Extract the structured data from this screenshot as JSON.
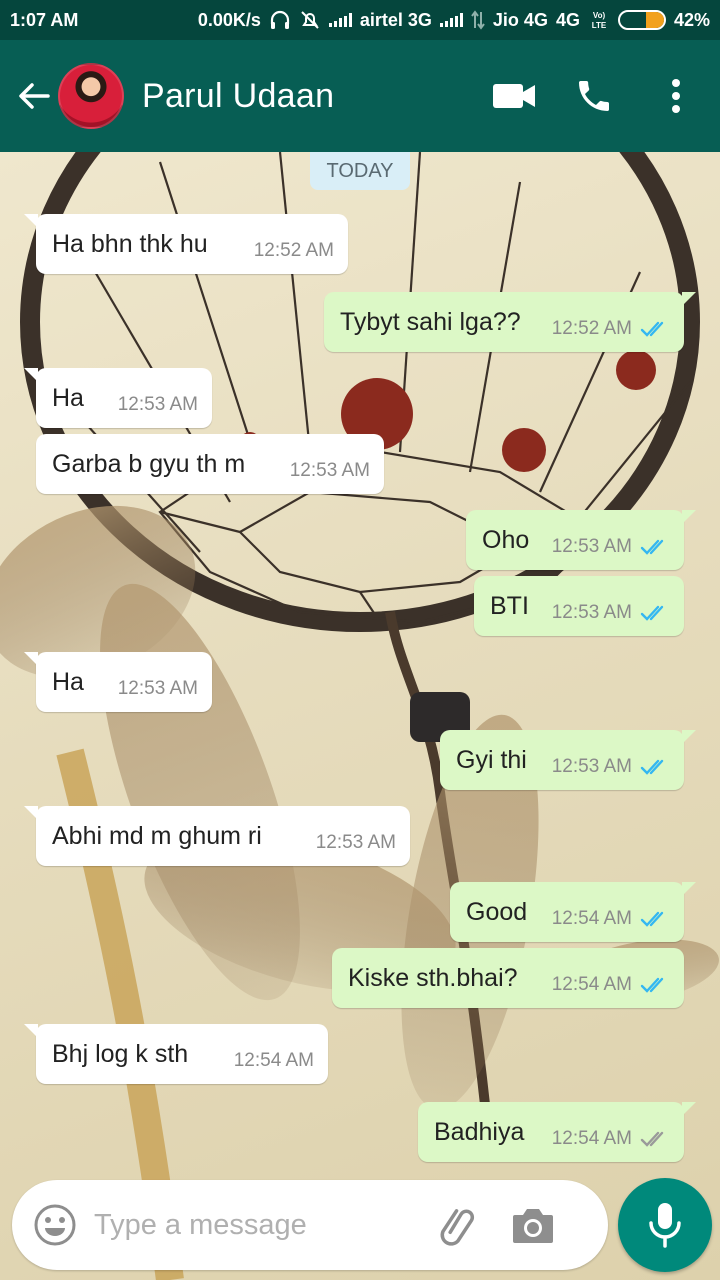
{
  "status_bar": {
    "time": "1:07 AM",
    "speed": "0.00K/s",
    "carrier1": "airtel 3G",
    "carrier2": "Jio 4G",
    "network2": "4G",
    "volte": "Vo) LTE",
    "battery": "42%",
    "battery_level": 0.42,
    "battery_color": "#f2a11d"
  },
  "header": {
    "contact_name": "Parul Udaan",
    "back_icon": "arrow-left-icon",
    "video_icon": "video-camera-icon",
    "call_icon": "phone-icon",
    "menu_icon": "more-vertical-icon",
    "color": "#075e54"
  },
  "date_chip": "TODAY",
  "messages": [
    {
      "dir": "in",
      "text": "Ha bhn thk hu",
      "time": "12:52 AM"
    },
    {
      "dir": "out",
      "text": "Tybyt sahi lga??",
      "time": "12:52 AM",
      "ticks": "read"
    },
    {
      "dir": "in",
      "text": "Ha",
      "time": "12:53 AM"
    },
    {
      "dir": "in",
      "text": "Garba b gyu th m",
      "time": "12:53 AM"
    },
    {
      "dir": "out",
      "text": "Oho",
      "time": "12:53 AM",
      "ticks": "read"
    },
    {
      "dir": "out",
      "text": "BTI",
      "time": "12:53 AM",
      "ticks": "read"
    },
    {
      "dir": "in",
      "text": "Ha",
      "time": "12:53 AM"
    },
    {
      "dir": "out",
      "text": "Gyi thi",
      "time": "12:53 AM",
      "ticks": "read"
    },
    {
      "dir": "in",
      "text": "Abhi md m ghum ri",
      "time": "12:53 AM"
    },
    {
      "dir": "out",
      "text": "Good",
      "time": "12:54 AM",
      "ticks": "read"
    },
    {
      "dir": "out",
      "text": "Kiske sth.bhai?",
      "time": "12:54 AM",
      "ticks": "read"
    },
    {
      "dir": "in",
      "text": "Bhj log k sth",
      "time": "12:54 AM"
    },
    {
      "dir": "out",
      "text": "Badhiya",
      "time": "12:54 AM",
      "ticks": "delivered"
    }
  ],
  "input": {
    "placeholder": "Type a message",
    "value": "",
    "emoji_icon": "emoji-icon",
    "attach_icon": "paperclip-icon",
    "camera_icon": "camera-icon",
    "mic_icon": "microphone-icon"
  },
  "colors": {
    "incoming": "#ffffff",
    "outgoing": "#dcf8c6",
    "read_tick": "#34b7f1",
    "delivered_tick": "#9a9a9a",
    "mic_button": "#00897b"
  }
}
